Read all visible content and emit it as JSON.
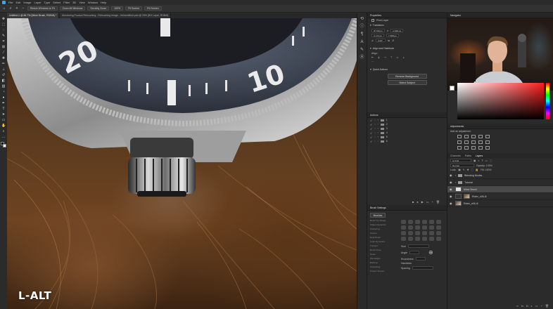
{
  "menubar": {
    "items": [
      "File",
      "Edit",
      "Image",
      "Layer",
      "Type",
      "Select",
      "Filter",
      "3D",
      "View",
      "Window",
      "Help"
    ]
  },
  "options": {
    "buttons": [
      "Resize Windows to Fit",
      "Zoom All Windows",
      "Scrubby Zoom",
      "100%",
      "Fit Screen",
      "Fill Screen"
    ]
  },
  "doctabs": [
    {
      "label": "Untitled-1 @ 66.7% (Mixer Brush, RGB/8) *",
      "active": true
    },
    {
      "label": "Monitoring Product Retouching - Retouching Image - Velmontfluid.psb @ 25% (BG Layer, RGB/8)",
      "active": false
    }
  ],
  "canvas": {
    "bezel_numbers": [
      "20",
      "10"
    ],
    "key_overlay": "L-ALT"
  },
  "properties": {
    "tab": "Properties",
    "layer_type": "Pixel Layer",
    "transform_head": "Transform",
    "w": "W 790 px",
    "h": "H 904 px",
    "x": "X 172 px",
    "y": "Y 508 px",
    "angle": "0.00°",
    "align_head": "Align and Distribute",
    "align_label": "Align:",
    "quick_head": "Quick Actions",
    "remove_bg": "Remove Background",
    "select_subject": "Select Subject"
  },
  "actions": {
    "tab": "Actions",
    "rows": [
      "1",
      "2",
      "3",
      "4",
      "5",
      "6"
    ]
  },
  "brush_settings": {
    "tab": "Brush Settings",
    "brushes_label": "Brushes",
    "options": [
      "Brush Tip Shape",
      "Shape Dynamics",
      "Scattering",
      "Texture",
      "Dual Brush",
      "Color Dynamics",
      "Transfer",
      "Brush Pose",
      "Noise",
      "Wet Edges",
      "Build-up",
      "Smoothing",
      "Protect Texture"
    ],
    "size_label": "Size",
    "angle_label": "Angle",
    "roundness_label": "Roundness",
    "hardness_label": "Hardness",
    "spacing_label": "Spacing"
  },
  "navigator": {
    "tab": "Navigator"
  },
  "adjustments": {
    "tab": "Adjustments",
    "add_label": "Add an adjustment"
  },
  "layers": {
    "tabs": [
      "Channels",
      "Paths",
      "Layers"
    ],
    "kind": "Q Kind",
    "blend": "Normal",
    "opacity": "Opacity: 100%",
    "lock": "Lock:",
    "fill": "Fill: 100%",
    "rows": [
      {
        "name": "Blending Modes",
        "type": "folder"
      },
      {
        "name": "Tutorial",
        "type": "folder"
      },
      {
        "name": "Mixer Brush",
        "type": "white",
        "selected": true
      },
      {
        "name": "Rolex_c06-4l",
        "type": "dark"
      },
      {
        "name": "Rolex_c06-4l",
        "type": "photo"
      }
    ]
  }
}
